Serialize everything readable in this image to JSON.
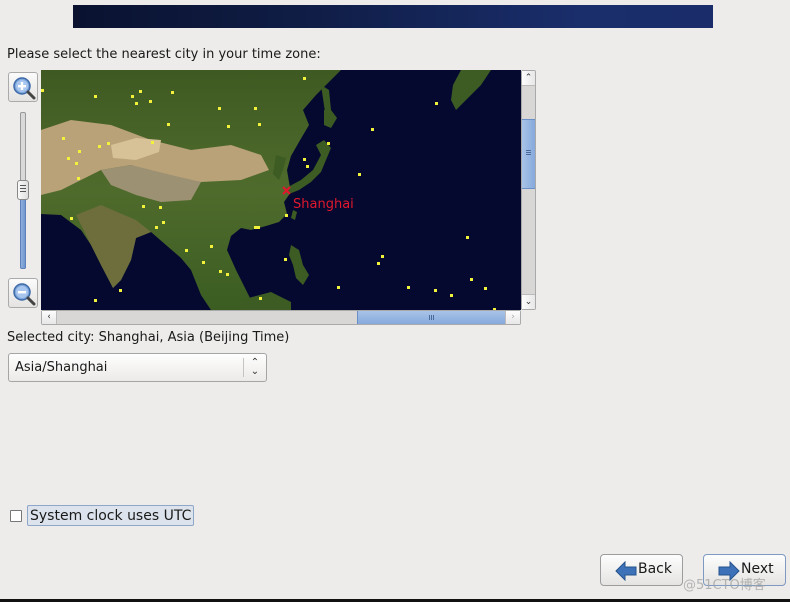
{
  "header": {
    "banner": "top-decorative-banner"
  },
  "prompt": "Please select the nearest city in your time zone:",
  "map": {
    "zoom_in_icon": "zoom-in-magnifier-icon",
    "zoom_out_icon": "zoom-out-magnifier-icon",
    "zoom_level_fraction": 0.47,
    "selected_marker_label": "Shanghai",
    "marker_color": "#e0182e",
    "city_dot_color": "#f2f23a",
    "ocean_color": "#05082f"
  },
  "selected_city_text": "Selected city: Shanghai, Asia (Beijing Time)",
  "timezone_combo": {
    "value": "Asia/Shanghai"
  },
  "utc_checkbox": {
    "label": "System clock uses UTC",
    "checked": false
  },
  "buttons": {
    "back": "Back",
    "next": "Next"
  },
  "watermark": "@51CTO博客"
}
